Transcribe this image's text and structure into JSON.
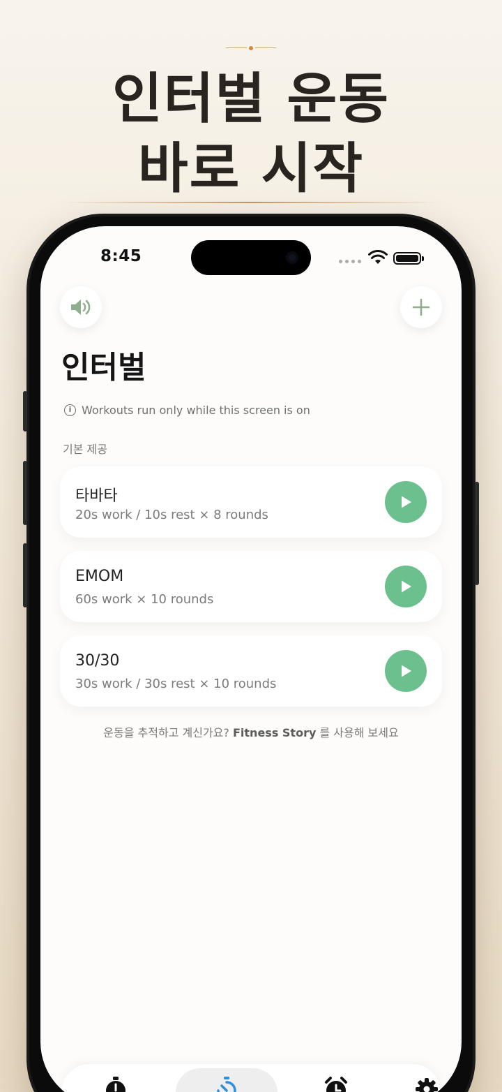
{
  "promo_header": {
    "line1": "인터벌 운동",
    "line2": "바로 시작"
  },
  "status_bar": {
    "time": "8:45"
  },
  "header": {
    "title": "인터벌",
    "info_text": "Workouts run only while this screen is on",
    "sound_icon": "speaker-icon",
    "add_icon": "plus-icon"
  },
  "section_label": "기본 제공",
  "workouts": [
    {
      "name": "타바타",
      "description": "20s work / 10s rest × 8 rounds"
    },
    {
      "name": "EMOM",
      "description": "60s work × 10 rounds"
    },
    {
      "name": "30/30",
      "description": "30s work / 30s rest × 10 rounds"
    }
  ],
  "footer_promo": {
    "prefix": "운동을 추적하고 계신가요?",
    "app_name": "Fitness Story",
    "suffix": "를 사용해 보세요"
  },
  "tabs": [
    {
      "icon": "stopwatch-icon"
    },
    {
      "icon": "interval-timer-icon",
      "active": true
    },
    {
      "icon": "alarm-clock-icon"
    },
    {
      "icon": "settings-gear-icon"
    }
  ],
  "colors": {
    "accent_green": "#6cc08e",
    "active_tab_blue": "#2f8fdc",
    "icon_green_gray": "#8fae8f"
  }
}
